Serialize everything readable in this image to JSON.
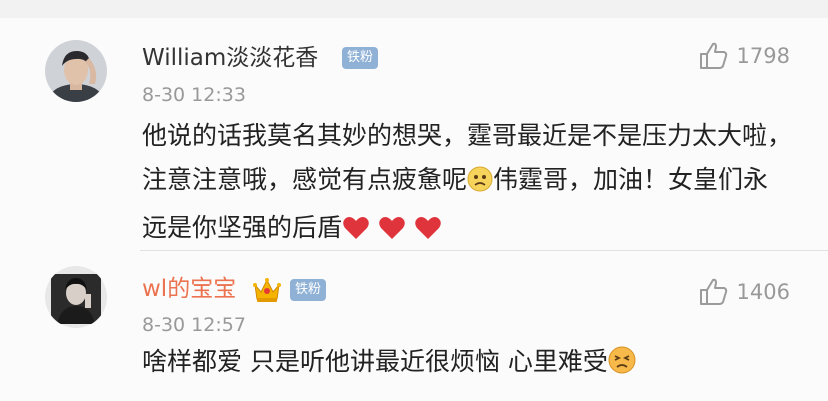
{
  "comments": [
    {
      "username": "William淡淡花香",
      "badge": "铁粉",
      "timestamp": "8-30 12:33",
      "like_count": "1798",
      "text_parts": [
        "他说的话我莫名其妙的想哭，霆哥最近是不是压力太大啦，注意注意哦，感觉有点疲惫呢",
        "伟霆哥，加油！女皇们永远是你坚强的后盾"
      ],
      "emojis": [
        "worried-face",
        "heart",
        "heart",
        "heart"
      ]
    },
    {
      "username": "wl的宝宝",
      "badge": "铁粉",
      "timestamp": "8-30 12:57",
      "like_count": "1406",
      "text": "啥样都爱 只是听他讲最近很烦恼 心里难受",
      "emojis": [
        "crown",
        "persevering-face"
      ]
    }
  ],
  "colors": {
    "username_default": "#333333",
    "username_vip": "#eb7350",
    "badge_bg": "#8fb1d6",
    "meta_gray": "#999999",
    "heart": "#e0343c"
  }
}
